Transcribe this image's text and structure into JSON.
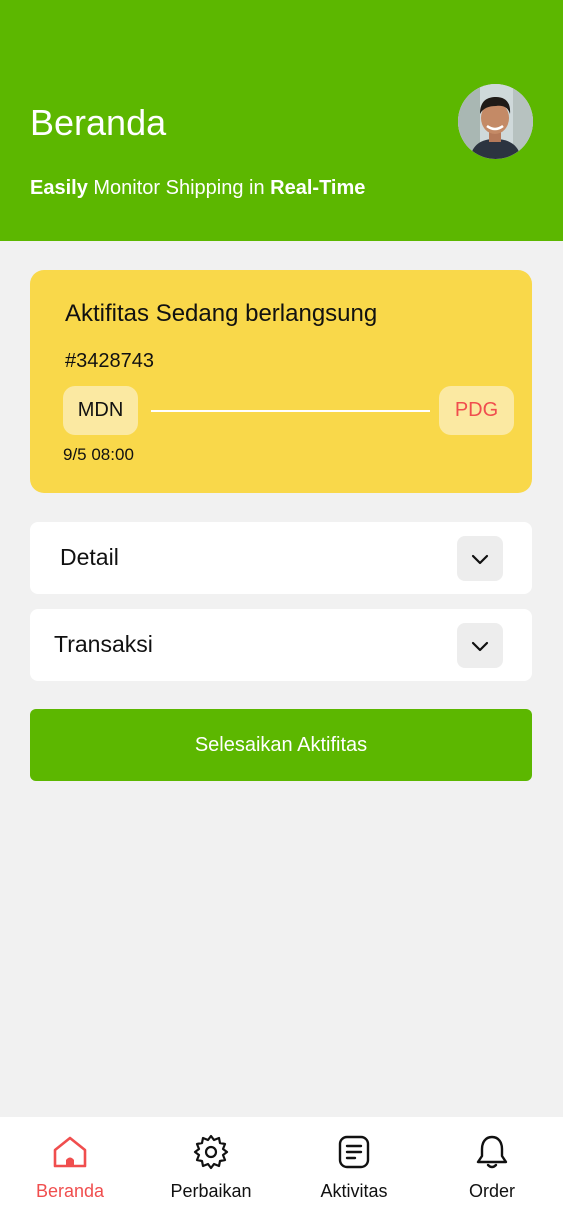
{
  "header": {
    "title": "Beranda",
    "subtitle_bold_1": "Easily",
    "subtitle_mid": " Monitor Shipping in ",
    "subtitle_bold_2": "Real-Time",
    "bg_color": "#5CB700"
  },
  "activity_card": {
    "title": "Aktifitas Sedang berlangsung",
    "order_id": "#3428743",
    "origin": "MDN",
    "destination": "PDG",
    "time": "9/5 08:00",
    "bg_color": "#F9D84A"
  },
  "sections": [
    {
      "label": "Detail",
      "icon": "chevron-down-icon"
    },
    {
      "label": "Transaksi",
      "icon": "chevron-down-icon"
    }
  ],
  "cta": {
    "label": "Selesaikan Aktifitas"
  },
  "nav": {
    "items": [
      {
        "label": "Beranda",
        "icon": "home-icon",
        "active": true
      },
      {
        "label": "Perbaikan",
        "icon": "gear-icon",
        "active": false
      },
      {
        "label": "Aktivitas",
        "icon": "document-icon",
        "active": false
      },
      {
        "label": "Order",
        "icon": "bell-icon",
        "active": false
      }
    ],
    "active_color": "#F04E4E"
  }
}
